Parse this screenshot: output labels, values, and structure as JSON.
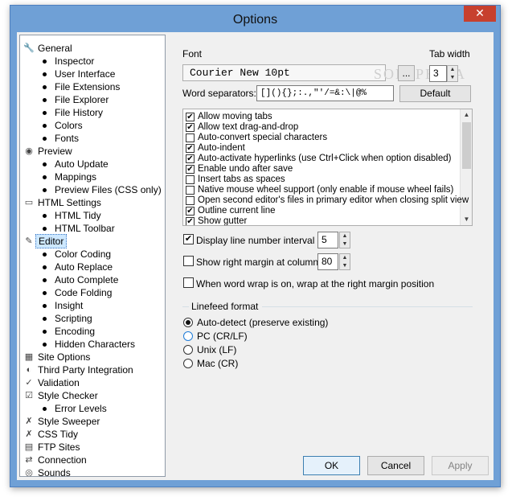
{
  "window": {
    "title": "Options",
    "close_glyph": "✕"
  },
  "tree": [
    {
      "label": "General",
      "icon": "wrench-icon",
      "glyph": "🔧",
      "child": false
    },
    {
      "label": "Inspector",
      "child": true
    },
    {
      "label": "User Interface",
      "child": true
    },
    {
      "label": "File Extensions",
      "child": true
    },
    {
      "label": "File Explorer",
      "child": true
    },
    {
      "label": "File History",
      "child": true
    },
    {
      "label": "Colors",
      "child": true
    },
    {
      "label": "Fonts",
      "child": true
    },
    {
      "label": "Preview",
      "icon": "preview-icon",
      "glyph": "◉",
      "child": false
    },
    {
      "label": "Auto Update",
      "child": true
    },
    {
      "label": "Mappings",
      "child": true
    },
    {
      "label": "Preview Files (CSS only)",
      "child": true
    },
    {
      "label": "HTML Settings",
      "icon": "html-icon",
      "glyph": "▭",
      "child": false
    },
    {
      "label": "HTML Tidy",
      "child": true
    },
    {
      "label": "HTML Toolbar",
      "child": true
    },
    {
      "label": "Editor",
      "icon": "pencil-icon",
      "glyph": "✎",
      "child": false,
      "selected": true
    },
    {
      "label": "Color Coding",
      "child": true
    },
    {
      "label": "Auto Replace",
      "child": true
    },
    {
      "label": "Auto Complete",
      "child": true
    },
    {
      "label": "Code Folding",
      "child": true
    },
    {
      "label": "Insight",
      "child": true
    },
    {
      "label": "Scripting",
      "child": true
    },
    {
      "label": "Encoding",
      "child": true
    },
    {
      "label": "Hidden Characters",
      "child": true
    },
    {
      "label": "Site Options",
      "icon": "site-icon",
      "glyph": "▦",
      "child": false
    },
    {
      "label": "Third Party Integration",
      "icon": "integration-icon",
      "glyph": "◐",
      "child": false
    },
    {
      "label": "Validation",
      "icon": "validation-icon",
      "glyph": "✓",
      "child": false
    },
    {
      "label": "Style Checker",
      "icon": "checker-icon",
      "glyph": "☑",
      "child": false
    },
    {
      "label": "Error Levels",
      "child": true
    },
    {
      "label": "Style Sweeper",
      "icon": "sweeper-icon",
      "glyph": "✗",
      "child": false
    },
    {
      "label": "CSS Tidy",
      "icon": "css-icon",
      "glyph": "✗",
      "child": false
    },
    {
      "label": "FTP Sites",
      "icon": "ftp-icon",
      "glyph": "▤",
      "child": false
    },
    {
      "label": "Connection",
      "icon": "connection-icon",
      "glyph": "⇄",
      "child": false
    },
    {
      "label": "Sounds",
      "icon": "sounds-icon",
      "glyph": "◎",
      "child": false
    }
  ],
  "editor": {
    "font_label": "Font",
    "font_value": "Courier New 10pt",
    "font_browse": "...",
    "tab_width_label": "Tab width",
    "tab_width_value": "3",
    "word_sep_label": "Word separators:",
    "word_sep_value": "[](){};:.,\"'/=&:\\|@%",
    "default_button": "Default",
    "watermark": "SOFTPEDIA",
    "options": [
      {
        "label": "Allow moving tabs",
        "checked": true
      },
      {
        "label": "Allow text drag-and-drop",
        "checked": true
      },
      {
        "label": "Auto-convert special characters",
        "checked": false
      },
      {
        "label": "Auto-indent",
        "checked": true
      },
      {
        "label": "Auto-activate hyperlinks (use Ctrl+Click when option disabled)",
        "checked": true
      },
      {
        "label": "Enable undo after save",
        "checked": true
      },
      {
        "label": "Insert tabs as spaces",
        "checked": false
      },
      {
        "label": "Native mouse wheel support (only enable if mouse wheel fails)",
        "checked": false
      },
      {
        "label": "Open second editor's files in primary editor when closing split view",
        "checked": false
      },
      {
        "label": "Outline current line",
        "checked": true
      },
      {
        "label": "Show gutter",
        "checked": true
      }
    ],
    "line_interval_label": "Display line number interval",
    "line_interval_checked": true,
    "line_interval_value": "5",
    "right_margin_label": "Show right margin at column",
    "right_margin_checked": false,
    "right_margin_value": "80",
    "wrap_label": "When word wrap is on, wrap at the right margin position",
    "wrap_checked": false,
    "linefeed_label": "Linefeed format",
    "linefeed_options": [
      {
        "label": "Auto-detect (preserve existing)",
        "selected": true
      },
      {
        "label": "PC (CR/LF)",
        "selected": false
      },
      {
        "label": "Unix (LF)",
        "selected": false
      },
      {
        "label": "Mac (CR)",
        "selected": false
      }
    ]
  },
  "buttons": {
    "ok": "OK",
    "cancel": "Cancel",
    "apply": "Apply"
  },
  "checkmark": "✔"
}
